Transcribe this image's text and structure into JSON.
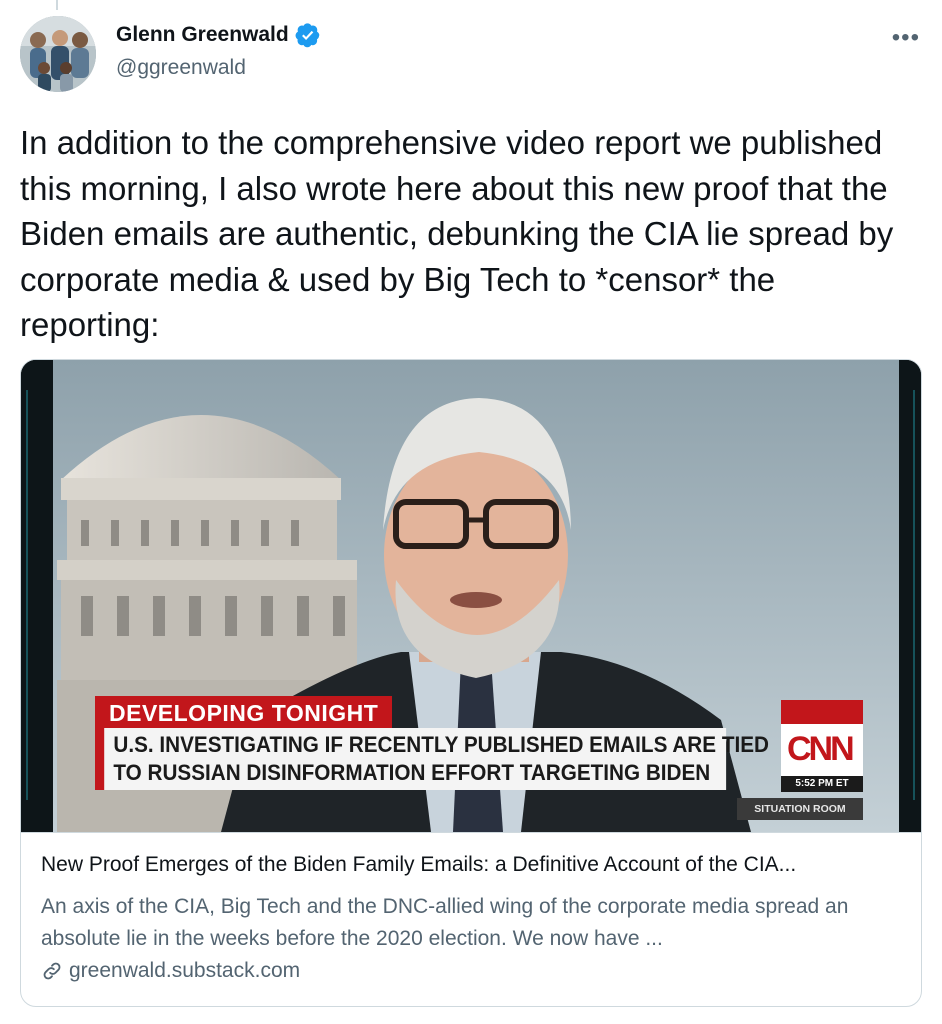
{
  "tweet": {
    "author": {
      "display_name": "Glenn Greenwald",
      "handle": "@ggreenwald",
      "verified": true,
      "verified_icon": "verified-badge-icon",
      "avatar_icon": "avatar-photo"
    },
    "more_label": "•••",
    "text": "In addition to the comprehensive video report we published this morning, I also wrote here about this new proof that the Biden emails are authentic, debunking the CIA lie spread by corporate media & used by Big Tech to *censor* the reporting:",
    "card": {
      "image": {
        "chyron_top": "DEVELOPING TONIGHT",
        "chyron_line1": "U.S. INVESTIGATING IF RECENTLY PUBLISHED EMAILS ARE TIED",
        "chyron_line2": "TO RUSSIAN DISINFORMATION EFFORT TARGETING BIDEN",
        "network_logo": "CNN",
        "time": "5:52 PM ET",
        "show_name": "SITUATION ROOM"
      },
      "title": "New Proof Emerges of the Biden Family Emails: a Definitive Account of the CIA...",
      "description": "An axis of the CIA, Big Tech and the DNC-allied wing of the corporate media spread an absolute lie in the weeks before the 2020 election. We now have ...",
      "domain": "greenwald.substack.com",
      "domain_icon": "link-icon"
    }
  },
  "colors": {
    "text_primary": "#0f1419",
    "text_secondary": "#536471",
    "verified_blue": "#1d9bf0",
    "border": "#cfd9de",
    "cnn_red": "#c2161b"
  }
}
